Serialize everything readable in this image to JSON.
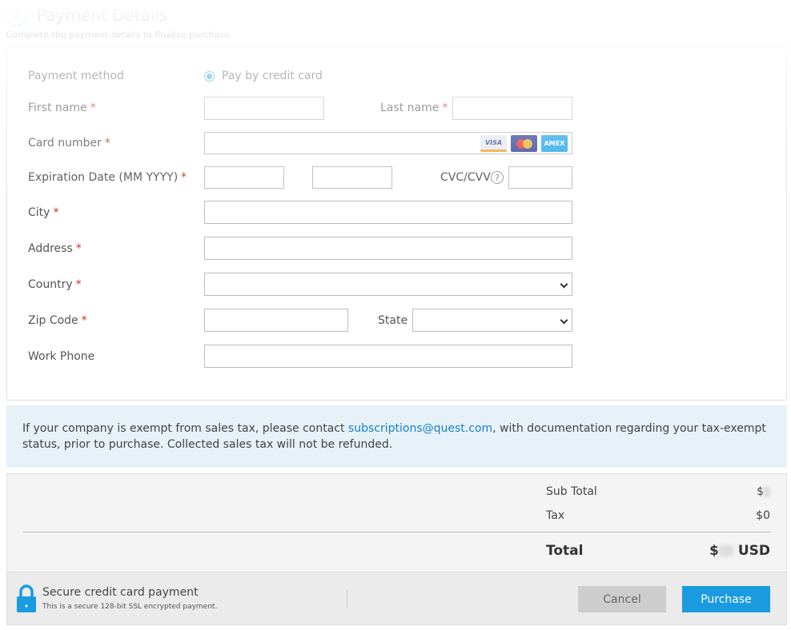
{
  "header": {
    "step": "3",
    "title": "Payment Details",
    "subtitle": "Complete the payment details to finalize purchase."
  },
  "form": {
    "payment_method_label": "Payment method",
    "payment_method_option": "Pay by credit card",
    "first_name_label": "First name",
    "last_name_label": "Last name",
    "card_number_label": "Card number",
    "card_brands": [
      "VISA",
      "mastercard",
      "AMEX"
    ],
    "expiration_label": "Expiration Date (MM YYYY)",
    "cvc_label": "CVC/CVV",
    "cvc_help": "?",
    "city_label": "City",
    "address_label": "Address",
    "country_label": "Country",
    "zip_label": "Zip Code",
    "state_label": "State",
    "work_phone_label": "Work Phone",
    "required_marker": "*"
  },
  "info": {
    "text_before": "If your company is exempt from sales tax, please contact ",
    "email": "subscriptions@quest.com",
    "text_after": ", with documentation regarding your tax-exempt status, prior to purchase. Collected sales tax will not be refunded."
  },
  "totals": {
    "subtotal_label": "Sub Total",
    "subtotal_currency": "$",
    "tax_label": "Tax",
    "tax_value": "$0",
    "total_label": "Total",
    "total_currency": "$",
    "total_unit": "USD"
  },
  "footer": {
    "secure_title": "Secure credit card payment",
    "secure_desc": "This is a secure 128-bit SSL encrypted payment.",
    "cancel": "Cancel",
    "purchase": "Purchase"
  },
  "colors": {
    "accent": "#1a9be0",
    "required": "#c0392b",
    "info_bg": "#e6f1f8"
  }
}
